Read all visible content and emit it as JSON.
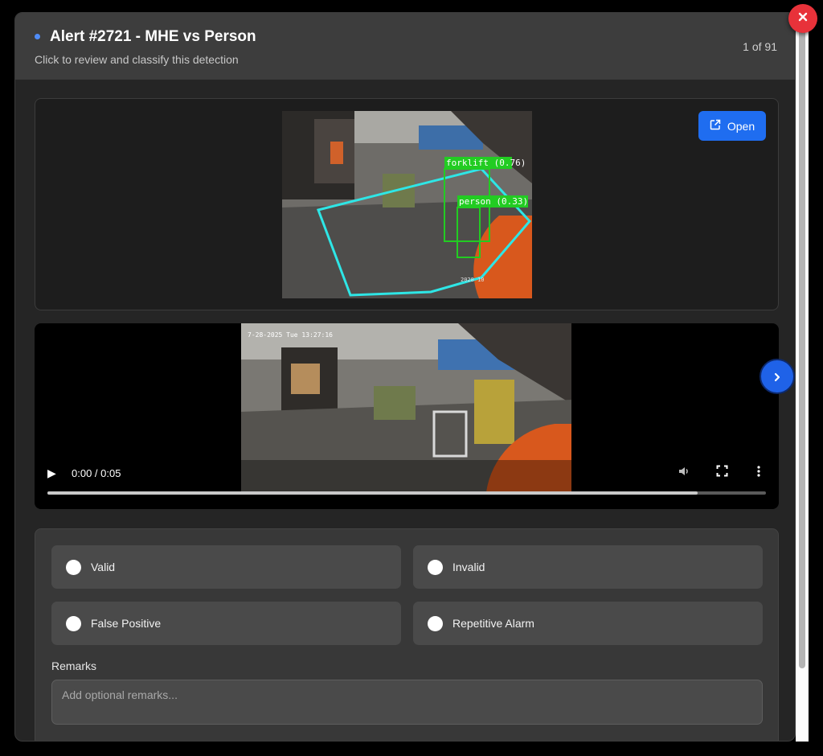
{
  "header": {
    "title": "Alert #2721 - MHE vs Person",
    "subtitle": "Click to review and classify this detection",
    "counter": "1 of 91"
  },
  "snapshot": {
    "open_label": "Open",
    "detections": [
      {
        "label": "forklift (0.76)"
      },
      {
        "label": "person (0.33)"
      }
    ],
    "overlay_text": "2028 10"
  },
  "video": {
    "timestamp_overlay": "7-28-2025 Tue 13:27:16",
    "time": "0:00 / 0:05",
    "progress": 0.905
  },
  "classification": {
    "options": [
      {
        "label": "Valid"
      },
      {
        "label": "Invalid"
      },
      {
        "label": "False Positive"
      },
      {
        "label": "Repetitive Alarm"
      }
    ],
    "remarks_label": "Remarks",
    "remarks_placeholder": "Add optional remarks..."
  },
  "icons": {
    "close": "close-icon",
    "next": "chevron-right-icon",
    "open": "external-link-icon"
  },
  "colors": {
    "accent": "#1f6df0",
    "close": "#e8323a",
    "detection_box": "#22cc22",
    "zone": "#2ee6e6"
  }
}
